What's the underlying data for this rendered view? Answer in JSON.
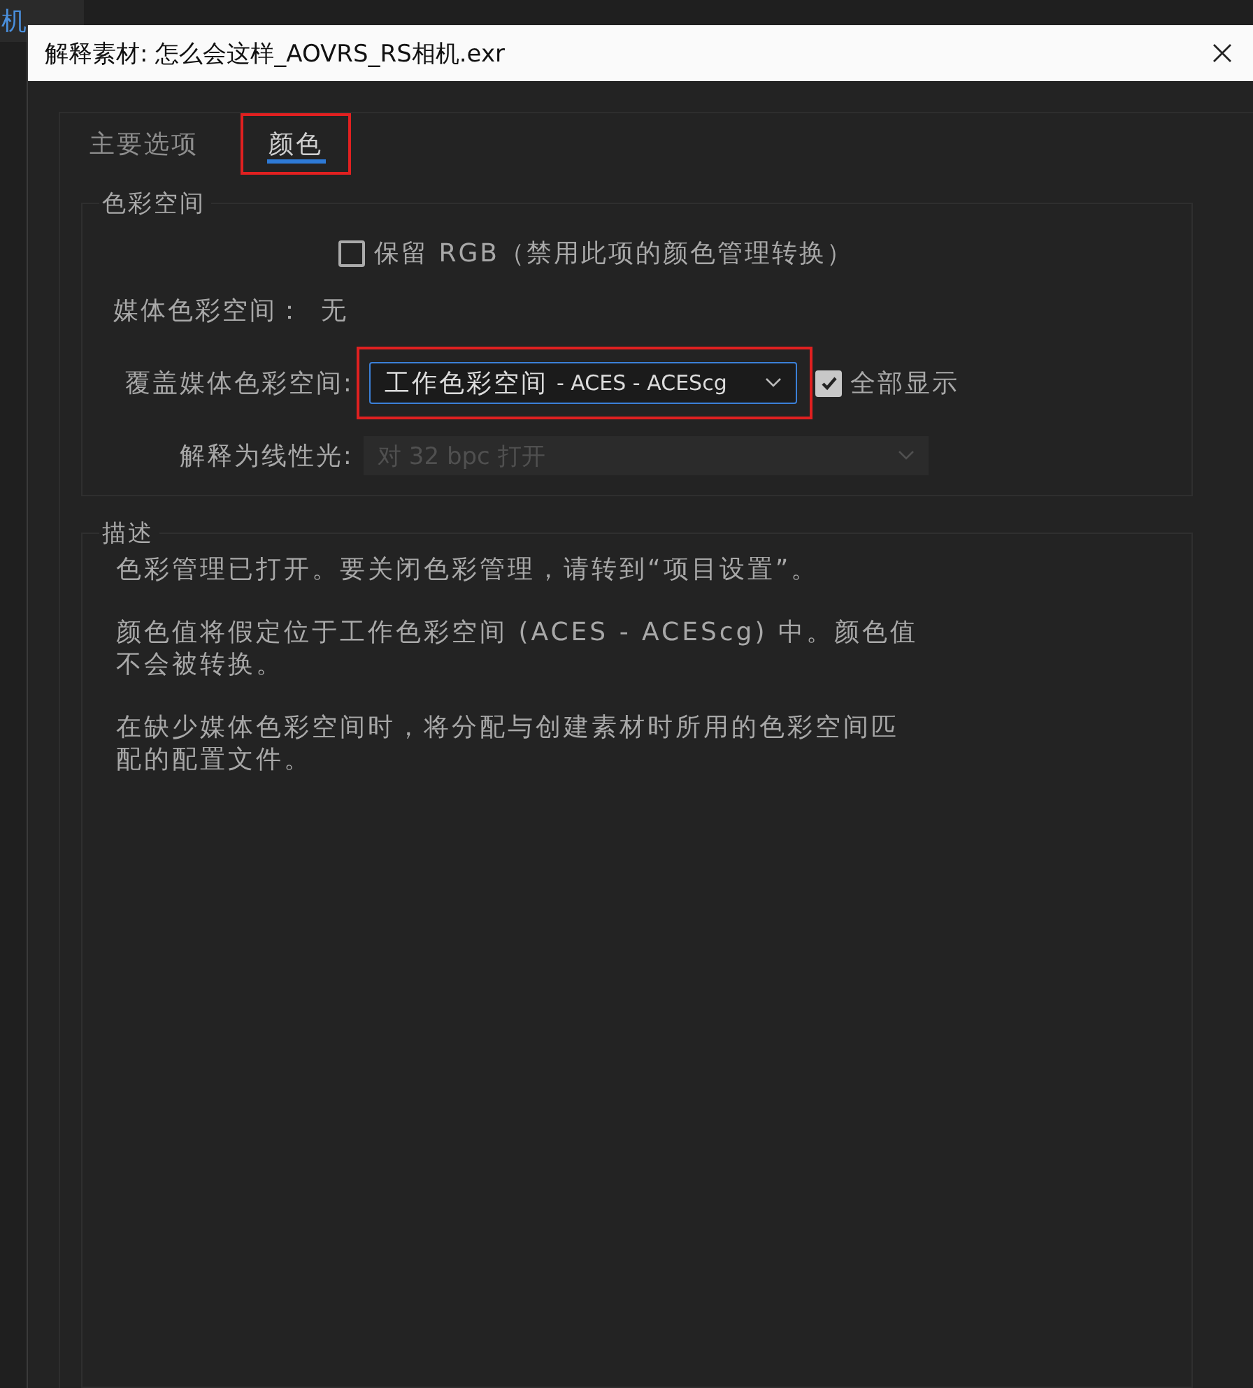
{
  "background": {
    "tab_label": "机"
  },
  "dialog": {
    "title": "解释素材: 怎么会这样_AOVRS_RS相机.exr"
  },
  "tabs": [
    {
      "label": "主要选项",
      "selected": false,
      "highlighted": false
    },
    {
      "label": "颜色",
      "selected": true,
      "highlighted": true
    }
  ],
  "color_space": {
    "legend": "色彩空间",
    "preserve_rgb": {
      "label": "保留 RGB（禁用此项的颜色管理转换）",
      "checked": false
    },
    "media_color_space": {
      "label": "媒体色彩空间：",
      "value": "无"
    },
    "override": {
      "label": "覆盖媒体色彩空间:",
      "value_main": "工作色彩空间",
      "value_detail": "- ACES - ACEScg",
      "highlighted": true
    },
    "show_all": {
      "label": "全部显示",
      "checked": true
    },
    "linear": {
      "label": "解释为线性光:",
      "value": "对 32 bpc 打开",
      "disabled": true
    }
  },
  "description": {
    "legend": "描述",
    "paragraphs": [
      "色彩管理已打开。要关闭色彩管理，请转到“项目设置”。",
      "颜色值将假定位于工作色彩空间 (ACES - ACEScg) 中。颜色值不会被转换。",
      "在缺少媒体色彩空间时，将分配与创建素材时所用的色彩空间匹配的配置文件。"
    ]
  }
}
